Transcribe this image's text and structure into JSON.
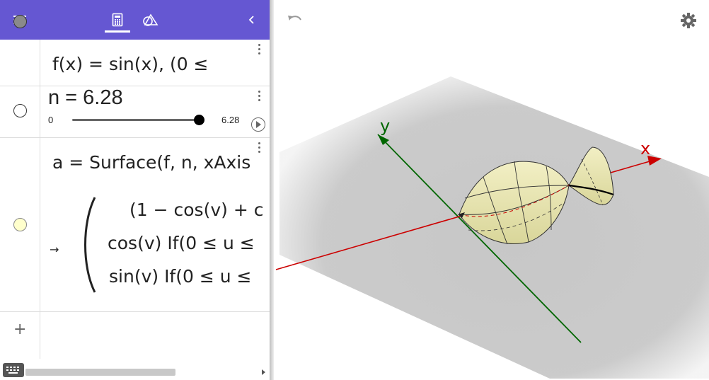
{
  "toolbar": {
    "menu_icon": "hamburger-menu-icon",
    "tabs": [
      {
        "name": "algebra-calculator-tab",
        "icon": "calculator-icon",
        "active": true
      },
      {
        "name": "tools-tab",
        "icon": "geometry-tools-icon",
        "active": false
      }
    ],
    "collapse_icon": "chevron-left-icon",
    "color": "#6557d2"
  },
  "algebra": {
    "rows": [
      {
        "marble_color": "#8a8a8a",
        "definition": "f(x) = sin(x),   (0 ≤"
      },
      {
        "marble_color": "#ffffff",
        "definition": "n = 6.28",
        "slider": {
          "min": "0",
          "max": "6.28",
          "value": 6.28
        }
      },
      {
        "marble_color": "#ffffcc",
        "definition": "a = Surface(f, n, xAxis",
        "result_arrow": "→",
        "matrix": [
          "(1 − cos(v) + c",
          "cos(v) If(0 ≤ u ≤",
          "sin(v) If(0 ≤ u ≤"
        ]
      }
    ],
    "add_label": "+"
  },
  "graphics": {
    "undo_icon": "undo-icon",
    "settings_icon": "gear-icon",
    "x_axis_label": "x",
    "y_axis_label": "y",
    "x_axis_color": "#cc0000",
    "y_axis_color": "#006600",
    "surface_color": "#ffffcc"
  },
  "bottom": {
    "keyboard_icon": "keyboard-icon"
  }
}
